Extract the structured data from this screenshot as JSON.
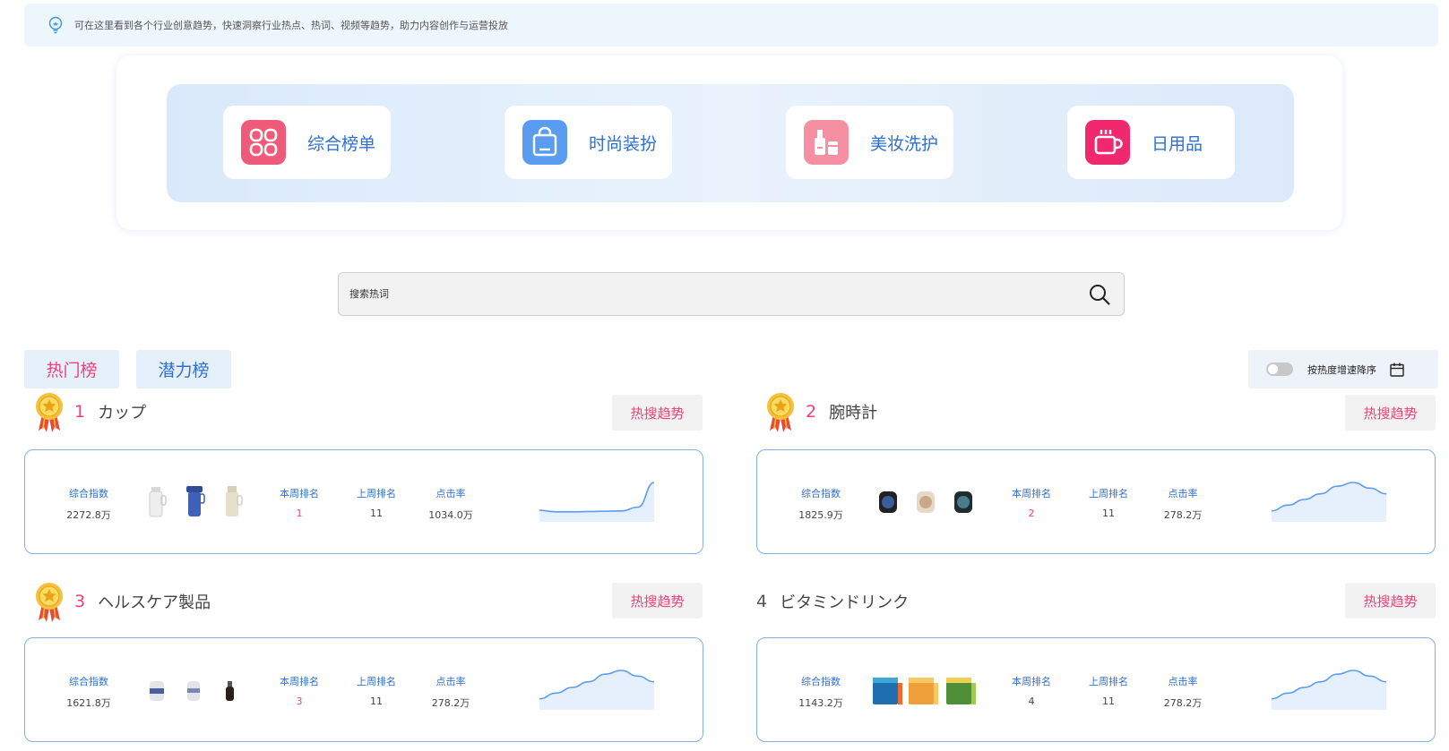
{
  "notice": {
    "text": "可在这里看到各个行业创意趋势，快速洞察行业热点、热词、视频等趋势，助力内容创作与运营投放"
  },
  "categories": [
    {
      "label": "综合榜单",
      "icon": "grid-icon",
      "color": "#ef5a7a"
    },
    {
      "label": "时尚装扮",
      "icon": "shopping-bag-icon",
      "color": "#5a9cf0"
    },
    {
      "label": "美妆洗护",
      "icon": "cosmetics-icon",
      "color": "#f590a2"
    },
    {
      "label": "日用品",
      "icon": "cup-icon",
      "color": "#f0286e"
    }
  ],
  "search": {
    "placeholder": "搜索热词"
  },
  "tabs": {
    "hot": "热门榜",
    "potential": "潜力榜"
  },
  "sort": {
    "label": "按热度增速降序"
  },
  "labels": {
    "index": "综合指数",
    "this_week": "本周排名",
    "last_week": "上周排名",
    "ctr": "点击率",
    "trend_button": "热搜趋势"
  },
  "items": [
    {
      "rank": "1",
      "keyword": "カップ",
      "index": "2272.8万",
      "this_week": "1",
      "last_week": "11",
      "ctr": "1034.0万",
      "medal": true,
      "trend": [
        4,
        3,
        3,
        3.2,
        3.4,
        3.6,
        6,
        22
      ]
    },
    {
      "rank": "2",
      "keyword": "腕時計",
      "index": "1825.9万",
      "this_week": "2",
      "last_week": "11",
      "ctr": "278.2万",
      "medal": true,
      "trend": [
        3,
        6,
        9,
        12,
        16,
        18,
        15,
        12
      ]
    },
    {
      "rank": "3",
      "keyword": "ヘルスケア製品",
      "index": "1621.8万",
      "this_week": "3",
      "last_week": "11",
      "ctr": "278.2万",
      "medal": true,
      "trend": [
        3,
        6,
        9,
        12,
        16,
        18,
        15,
        12
      ]
    },
    {
      "rank": "4",
      "keyword": "ビタミンドリンク",
      "index": "1143.2万",
      "this_week": "4",
      "last_week": "11",
      "ctr": "278.2万",
      "medal": false,
      "trend": [
        3,
        6,
        9,
        12,
        16,
        18,
        15,
        12
      ]
    }
  ],
  "colors": {
    "accent_blue": "#2d6fd6",
    "accent_pink": "#f0427a",
    "card_border": "#7fb0e8"
  }
}
